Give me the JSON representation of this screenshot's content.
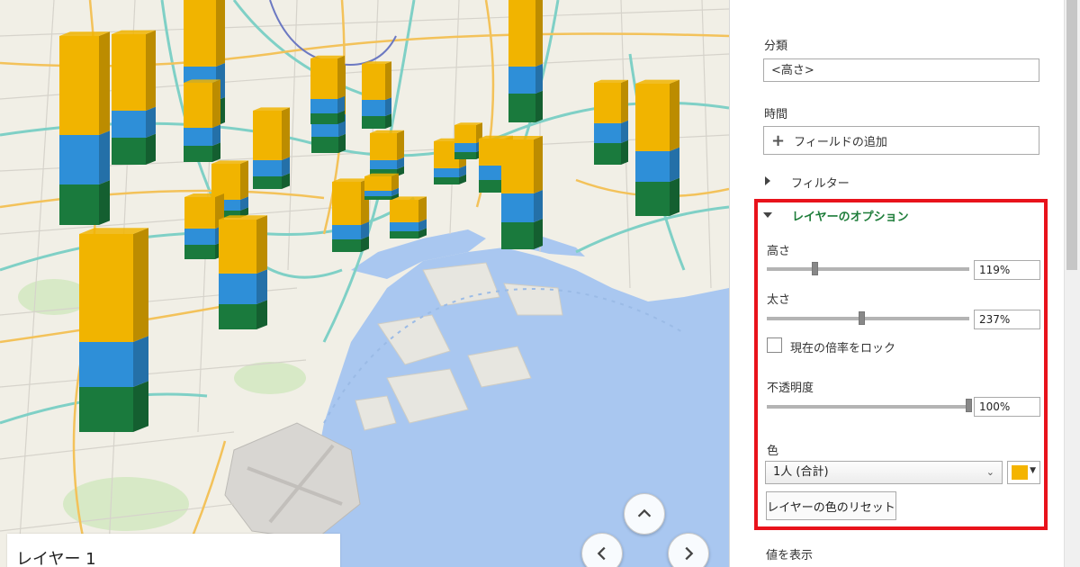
{
  "map": {
    "legend_title": "レイヤー 1",
    "series_colors": {
      "top": "#f1b400",
      "middle": "#2e8fd8",
      "bottom": "#1a7a3d"
    },
    "water_color": "#a9c7f0",
    "nav": {
      "up": "up-arrow",
      "left": "left-arrow",
      "right": "right-arrow"
    }
  },
  "panel": {
    "category_label": "分類",
    "category_value": "<高さ>",
    "time_label": "時間",
    "add_field_label": "フィールドの追加",
    "filter_label": "フィルター",
    "layer_options_label": "レイヤーのオプション",
    "height_label": "高さ",
    "height_value": "119%",
    "height_fraction": 0.24,
    "thickness_label": "太さ",
    "thickness_value": "237%",
    "thickness_fraction": 0.47,
    "lock_scale_label": "現在の倍率をロック",
    "opacity_label": "不透明度",
    "opacity_value": "100%",
    "opacity_fraction": 1.0,
    "color_label": "色",
    "color_series": "1人 (合計)",
    "color_swatch": "#f4b400",
    "reset_color_label": "レイヤーの色のリセット",
    "show_values_label": "値を表示",
    "highlight_color": "#e8121b",
    "section_color": "#1e7d3a"
  }
}
